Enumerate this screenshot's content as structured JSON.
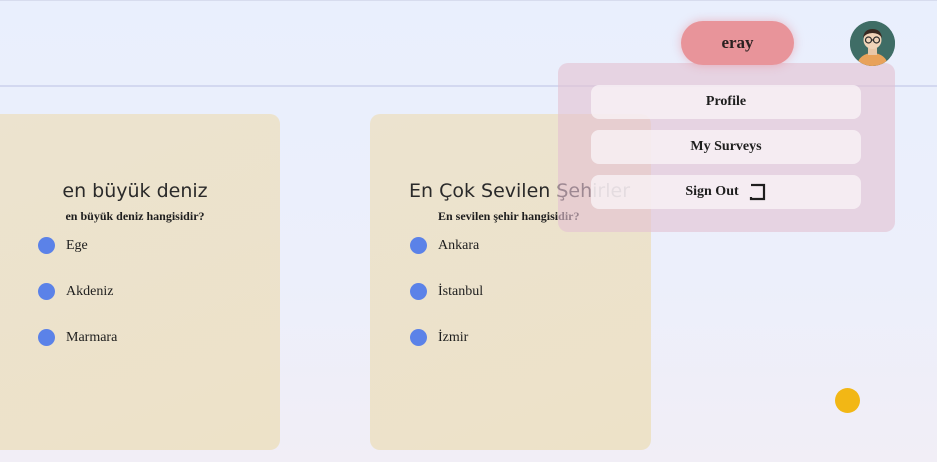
{
  "header": {
    "username": "eray"
  },
  "surveys": [
    {
      "title": "en büyük deniz",
      "question": "en büyük deniz hangisidir?",
      "options": [
        "Ege",
        "Akdeniz",
        "Marmara"
      ]
    },
    {
      "title": "En Çok Sevilen Şehirler",
      "question": "En sevilen şehir hangisidir?",
      "options": [
        "Ankara",
        "İstanbul",
        "İzmir"
      ]
    }
  ],
  "menu": {
    "profile": "Profile",
    "my_surveys": "My Surveys",
    "sign_out": "Sign Out"
  },
  "colors": {
    "user_button": "#e8949a",
    "radio": "#5b82e8",
    "fab": "#f2b715",
    "card": "#ece3cf",
    "dropdown": "#e4c2d2"
  },
  "icons": {
    "avatar": "user-avatar-glasses",
    "sign_out": "sign-out-icon",
    "fab": "help-circle"
  }
}
